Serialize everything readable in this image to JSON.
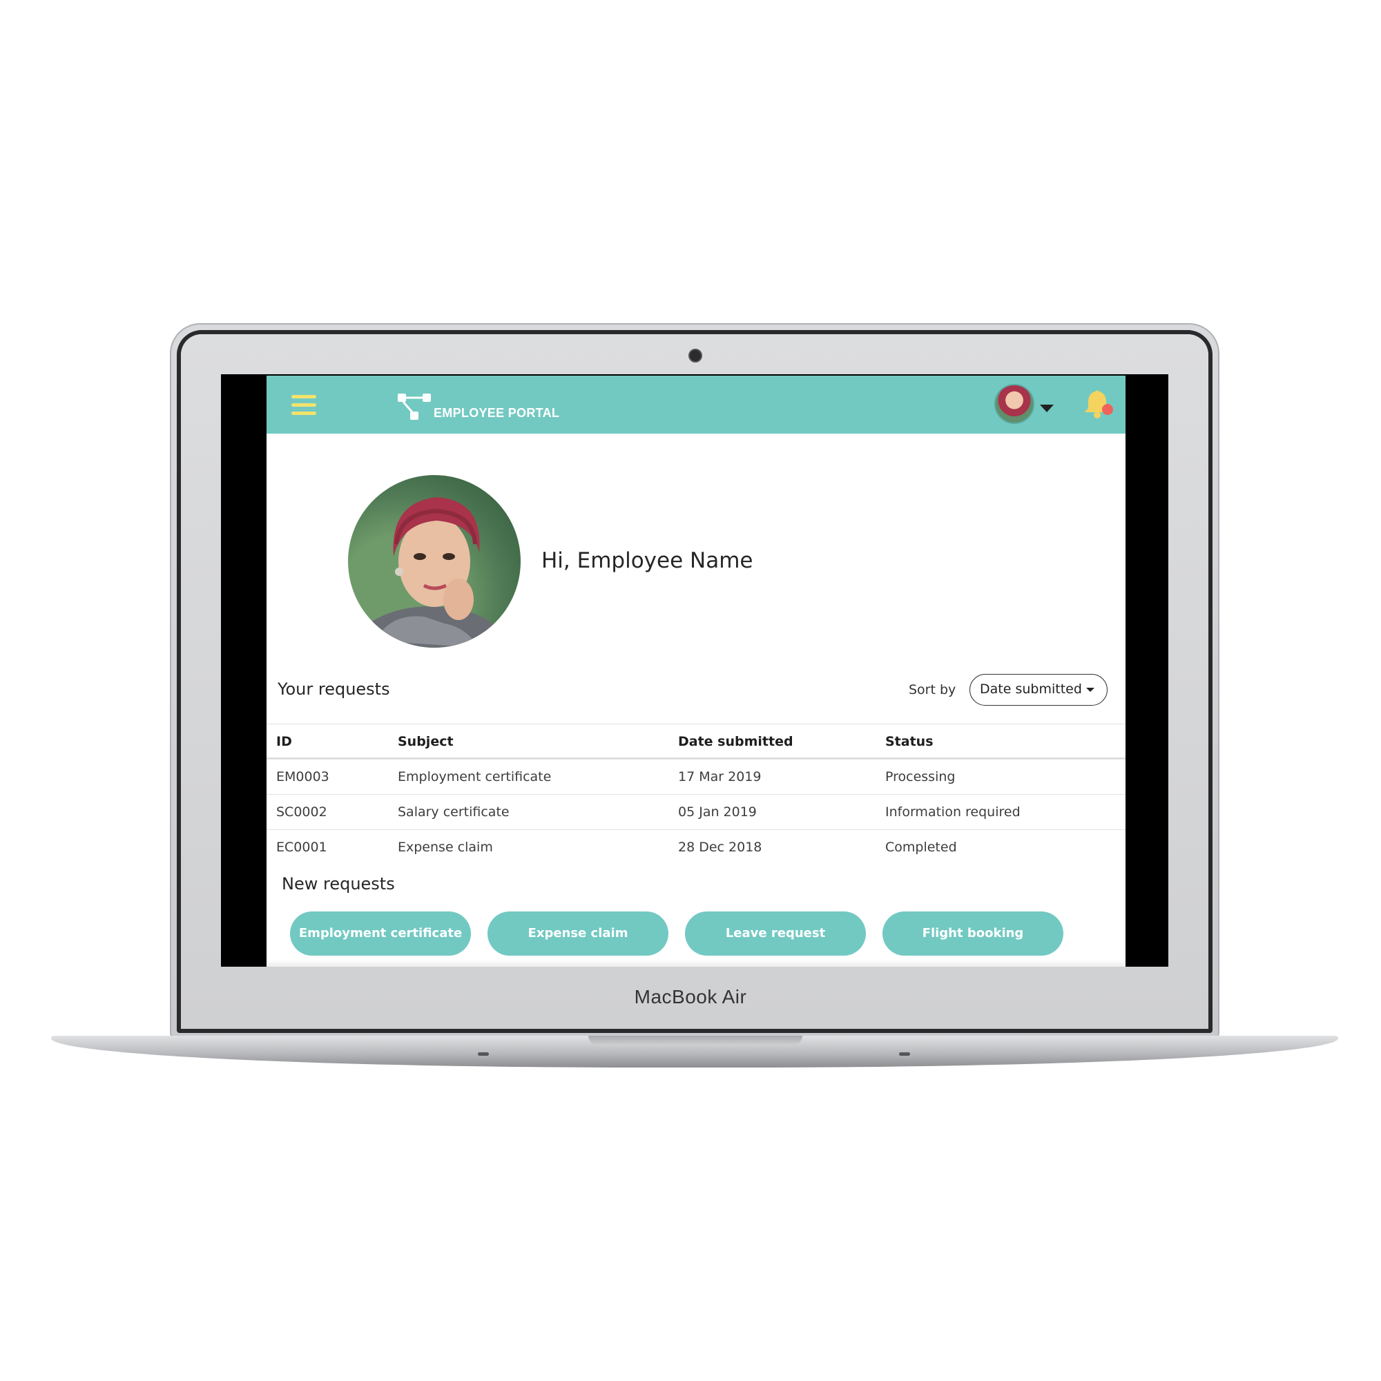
{
  "device": {
    "brand_label": "MacBook Air"
  },
  "header": {
    "title": "EMPLOYEE PORTAL",
    "accent_color": "#72c9c2",
    "menu_icon_color": "#f4e36a",
    "icons": [
      "hamburger-menu-icon",
      "portal-logo-icon",
      "user-avatar",
      "chevron-down-icon",
      "bell-icon"
    ],
    "notification_badge_color": "#f0625d"
  },
  "greeting": {
    "text": "Hi, Employee Name"
  },
  "requests": {
    "title": "Your requests",
    "sort_label": "Sort by",
    "sort_value": "Date submitted",
    "columns": [
      "ID",
      "Subject",
      "Date submitted",
      "Status"
    ],
    "rows": [
      {
        "id": "EM0003",
        "subject": "Employment certificate",
        "date": "17 Mar 2019",
        "status": "Processing"
      },
      {
        "id": "SC0002",
        "subject": "Salary certificate",
        "date": "05 Jan 2019",
        "status": "Information required"
      },
      {
        "id": "EC0001",
        "subject": "Expense claim",
        "date": "28 Dec 2018",
        "status": "Completed"
      }
    ]
  },
  "new_requests": {
    "title": "New requests",
    "buttons": [
      "Employment certificate",
      "Expense claim",
      "Leave request",
      "Flight booking"
    ]
  }
}
